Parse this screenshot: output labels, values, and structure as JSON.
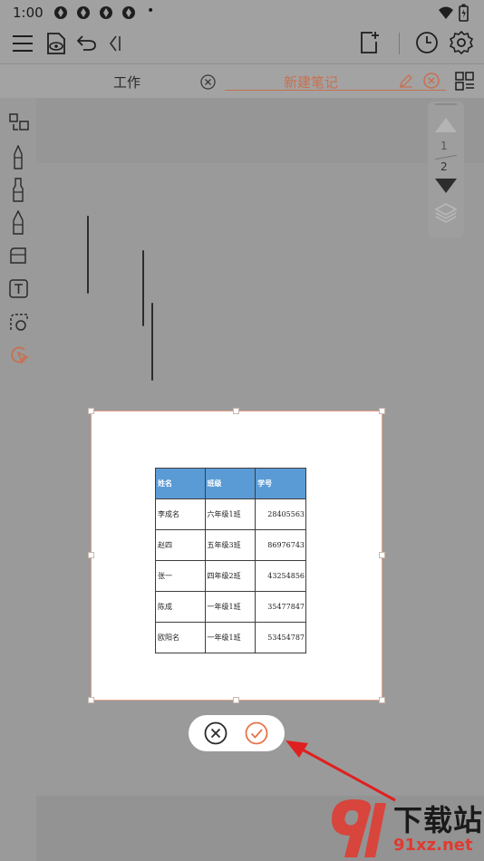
{
  "status_bar": {
    "time": "1:00",
    "dot": "•",
    "notification_icons": [
      "app-icon",
      "app-icon",
      "app-icon",
      "app-icon"
    ],
    "signal_icons": [
      "wifi-icon",
      "battery-icon"
    ]
  },
  "toolbar": {
    "icons": [
      "menu-icon",
      "preview-icon",
      "undo-icon",
      "collapse-icon",
      "add-page-icon",
      "history-icon",
      "settings-icon"
    ]
  },
  "tabs": [
    {
      "label": "工作",
      "active": false
    },
    {
      "label": "新建笔记",
      "active": true
    }
  ],
  "tab_icons": [
    "close-circle-icon",
    "edit-icon",
    "close-circle-icon",
    "grid-view-icon"
  ],
  "sidebar_tools": [
    "select-icon",
    "pen-icon",
    "marker-icon",
    "pencil-icon",
    "eraser-icon",
    "text-icon",
    "lasso-icon",
    "shape-icon"
  ],
  "pager": {
    "current": "1",
    "total": "2"
  },
  "table": {
    "headers": [
      "姓名",
      "班级",
      "学号"
    ],
    "rows": [
      [
        "李成名",
        "六年级1班",
        "28405563"
      ],
      [
        "赵四",
        "五年级3班",
        "86976743"
      ],
      [
        "张一",
        "四年级2班",
        "43254856"
      ],
      [
        "陈成",
        "一年级1班",
        "35477847"
      ],
      [
        "欧阳名",
        "一年级1班",
        "53454787"
      ]
    ]
  },
  "actions": {
    "cancel": "cancel-icon",
    "confirm": "confirm-icon"
  },
  "watermark": {
    "brand": "下载站",
    "domain": "91xz.net"
  },
  "colors": {
    "accent": "#c8704e",
    "header_blue": "#5b9bd5",
    "annotation_arrow": "#e02020"
  }
}
